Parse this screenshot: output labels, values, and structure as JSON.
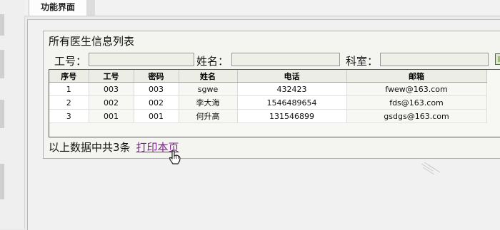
{
  "tab": {
    "label": "功能界面"
  },
  "panel": {
    "title": "所有医生信息列表"
  },
  "filters": {
    "id_label": "工号：",
    "name_label": "姓名：",
    "dept_label": "科室："
  },
  "table": {
    "headers": [
      "序号",
      "工号",
      "密码",
      "姓名",
      "电话",
      "邮箱"
    ],
    "rows": [
      [
        "1",
        "003",
        "003",
        "sgwe",
        "432423",
        "fwew@163.com"
      ],
      [
        "2",
        "002",
        "002",
        "李大海",
        "1546489654",
        "fds@163.com"
      ],
      [
        "3",
        "001",
        "001",
        "何升高",
        "131546899",
        "gsdgs@163.com"
      ]
    ]
  },
  "summary": {
    "text": "以上数据中共3条",
    "print_link": "打印本页"
  }
}
